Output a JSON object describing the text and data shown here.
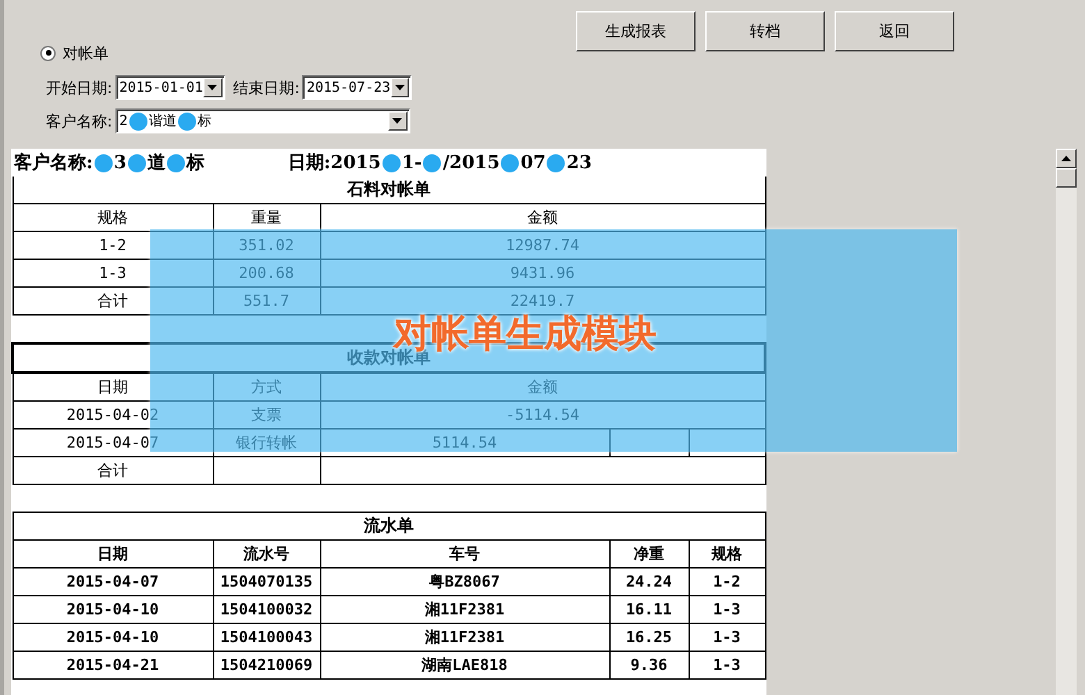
{
  "toolbar": {
    "buttons": [
      "生成报表",
      "转档",
      "返回"
    ]
  },
  "report_type": {
    "options": [
      {
        "label": "对帐单",
        "selected": true
      }
    ]
  },
  "filters": {
    "start_label": "开始日期:",
    "start_value": "2015-01-01",
    "end_label": "结束日期:",
    "end_value": "2015-07-23",
    "customer_label": "客户名称:",
    "customer_value": [
      {
        "kind": "text",
        "text": "2"
      },
      {
        "kind": "redaction"
      },
      {
        "kind": "text",
        "text": "谐道"
      },
      {
        "kind": "redaction"
      },
      {
        "kind": "text",
        "text": "标"
      }
    ]
  },
  "report": {
    "customer_label": "客户名称:",
    "customer_value": [
      {
        "kind": "redaction"
      },
      {
        "kind": "text",
        "text": "3"
      },
      {
        "kind": "redaction"
      },
      {
        "kind": "text",
        "text": "道"
      },
      {
        "kind": "redaction"
      },
      {
        "kind": "text",
        "text": "标"
      }
    ],
    "date_label": "日期:",
    "date_value": [
      {
        "kind": "text",
        "text": "2015"
      },
      {
        "kind": "redaction"
      },
      {
        "kind": "text",
        "text": "1-"
      },
      {
        "kind": "redaction"
      },
      {
        "kind": "text",
        "text": "/2015"
      },
      {
        "kind": "redaction"
      },
      {
        "kind": "text",
        "text": "07"
      },
      {
        "kind": "redaction"
      },
      {
        "kind": "text",
        "text": "23"
      }
    ],
    "stone": {
      "title": "石料对帐单",
      "columns": [
        "规格",
        "重量",
        "金额"
      ],
      "rows": [
        [
          "1-2",
          "351.02",
          "12987.74"
        ],
        [
          "1-3",
          "200.68",
          "9431.96"
        ],
        [
          "合计",
          "551.7",
          "22419.7"
        ]
      ]
    },
    "payments": {
      "title": "收款对帐单",
      "columns": [
        "日期",
        "方式",
        "金额"
      ],
      "rows": [
        [
          "2015-04-02",
          "支票",
          "-5114.54"
        ],
        [
          "2015-04-07",
          "银行转帐",
          "5114.54"
        ],
        [
          "合计",
          "",
          ""
        ]
      ]
    },
    "flow": {
      "title": "流水单",
      "columns": [
        "日期",
        "流水号",
        "车号",
        "净重",
        "规格"
      ],
      "rows": [
        [
          "2015-04-07",
          "1504070135",
          "粤BZ8067",
          "24.24",
          "1-2"
        ],
        [
          "2015-04-10",
          "1504100032",
          "湘11F2381",
          "16.11",
          "1-3"
        ],
        [
          "2015-04-10",
          "1504100043",
          "湘11F2381",
          "16.25",
          "1-3"
        ],
        [
          "2015-04-21",
          "1504210069",
          "湖南LAE818",
          "9.36",
          "1-3"
        ]
      ]
    }
  },
  "overlay": {
    "caption": "对帐单生成模块"
  }
}
